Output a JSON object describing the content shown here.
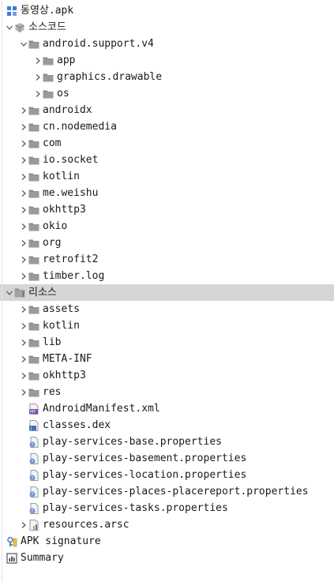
{
  "tree": [
    {
      "label": "동영상.apk",
      "depth": 0,
      "chevron": "none",
      "icon": "apk-icon",
      "selected": false
    },
    {
      "label": "소스코드",
      "depth": 0,
      "chevron": "down",
      "icon": "package-icon",
      "selected": false
    },
    {
      "label": "android.support.v4",
      "depth": 1,
      "chevron": "down",
      "icon": "folder-icon",
      "selected": false
    },
    {
      "label": "app",
      "depth": 2,
      "chevron": "right",
      "icon": "folder-icon",
      "selected": false
    },
    {
      "label": "graphics.drawable",
      "depth": 2,
      "chevron": "right",
      "icon": "folder-icon",
      "selected": false
    },
    {
      "label": "os",
      "depth": 2,
      "chevron": "right",
      "icon": "folder-icon",
      "selected": false
    },
    {
      "label": "androidx",
      "depth": 1,
      "chevron": "right",
      "icon": "folder-icon",
      "selected": false
    },
    {
      "label": "cn.nodemedia",
      "depth": 1,
      "chevron": "right",
      "icon": "folder-icon",
      "selected": false
    },
    {
      "label": "com",
      "depth": 1,
      "chevron": "right",
      "icon": "folder-icon",
      "selected": false
    },
    {
      "label": "io.socket",
      "depth": 1,
      "chevron": "right",
      "icon": "folder-icon",
      "selected": false
    },
    {
      "label": "kotlin",
      "depth": 1,
      "chevron": "right",
      "icon": "folder-icon",
      "selected": false
    },
    {
      "label": "me.weishu",
      "depth": 1,
      "chevron": "right",
      "icon": "folder-icon",
      "selected": false
    },
    {
      "label": "okhttp3",
      "depth": 1,
      "chevron": "right",
      "icon": "folder-icon",
      "selected": false
    },
    {
      "label": "okio",
      "depth": 1,
      "chevron": "right",
      "icon": "folder-icon",
      "selected": false
    },
    {
      "label": "org",
      "depth": 1,
      "chevron": "right",
      "icon": "folder-icon",
      "selected": false
    },
    {
      "label": "retrofit2",
      "depth": 1,
      "chevron": "right",
      "icon": "folder-icon",
      "selected": false
    },
    {
      "label": "timber.log",
      "depth": 1,
      "chevron": "right",
      "icon": "folder-icon",
      "selected": false
    },
    {
      "label": "리소스",
      "depth": 0,
      "chevron": "down",
      "icon": "resources-folder-icon",
      "selected": true
    },
    {
      "label": "assets",
      "depth": 1,
      "chevron": "right",
      "icon": "folder-icon",
      "selected": false
    },
    {
      "label": "kotlin",
      "depth": 1,
      "chevron": "right",
      "icon": "folder-icon",
      "selected": false
    },
    {
      "label": "lib",
      "depth": 1,
      "chevron": "right",
      "icon": "folder-icon",
      "selected": false
    },
    {
      "label": "META-INF",
      "depth": 1,
      "chevron": "right",
      "icon": "folder-icon",
      "selected": false
    },
    {
      "label": "okhttp3",
      "depth": 1,
      "chevron": "right",
      "icon": "folder-icon",
      "selected": false
    },
    {
      "label": "res",
      "depth": 1,
      "chevron": "right",
      "icon": "folder-icon",
      "selected": false
    },
    {
      "label": "AndroidManifest.xml",
      "depth": 1,
      "chevron": "none",
      "icon": "manifest-file-icon",
      "selected": false
    },
    {
      "label": "classes.dex",
      "depth": 1,
      "chevron": "none",
      "icon": "dex-file-icon",
      "selected": false
    },
    {
      "label": "play-services-base.properties",
      "depth": 1,
      "chevron": "none",
      "icon": "unknown-file-icon",
      "selected": false
    },
    {
      "label": "play-services-basement.properties",
      "depth": 1,
      "chevron": "none",
      "icon": "unknown-file-icon",
      "selected": false
    },
    {
      "label": "play-services-location.properties",
      "depth": 1,
      "chevron": "none",
      "icon": "unknown-file-icon",
      "selected": false
    },
    {
      "label": "play-services-places-placereport.properties",
      "depth": 1,
      "chevron": "none",
      "icon": "unknown-file-icon",
      "selected": false
    },
    {
      "label": "play-services-tasks.properties",
      "depth": 1,
      "chevron": "none",
      "icon": "unknown-file-icon",
      "selected": false
    },
    {
      "label": "resources.arsc",
      "depth": 1,
      "chevron": "right",
      "icon": "arsc-file-icon",
      "selected": false
    },
    {
      "label": "APK signature",
      "depth": 0,
      "chevron": "none",
      "icon": "signature-icon",
      "selected": false
    },
    {
      "label": "Summary",
      "depth": 0,
      "chevron": "none",
      "icon": "summary-icon",
      "selected": false
    }
  ],
  "colors": {
    "selected_bg": "#d6d6d6",
    "folder": "#8a8a8a",
    "chevron": "#555555",
    "apk_blue": "#3d7bd9",
    "manifest_purple": "#7a4fb3",
    "dex_blue": "#3a6fc4"
  }
}
